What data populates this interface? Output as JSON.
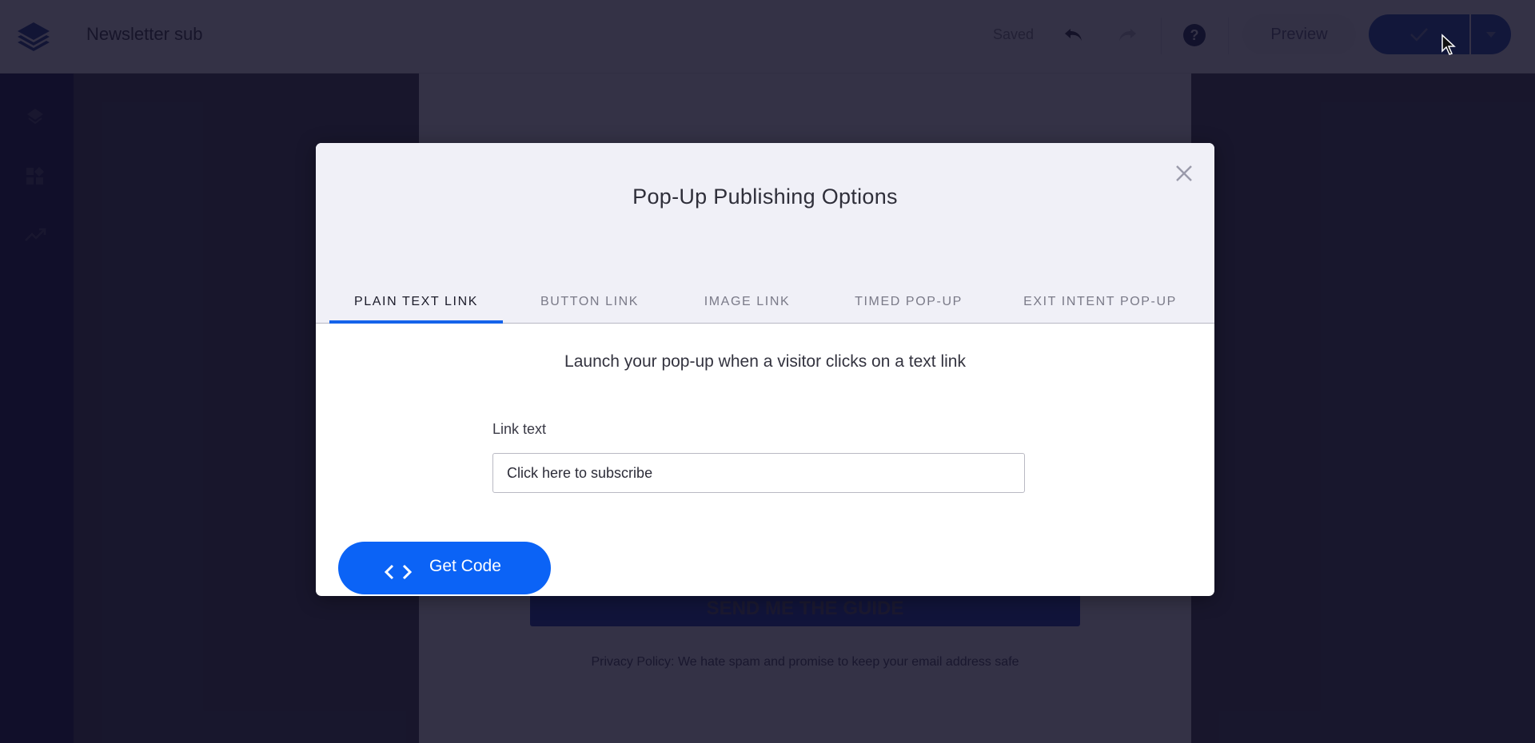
{
  "app": {
    "logo_icon": "layers-logo-icon",
    "document_title": "Newsletter sub",
    "save_status": "Saved",
    "toolbar": {
      "undo_icon": "undo-icon",
      "redo_icon": "redo-icon",
      "help_icon": "help-circle-icon",
      "preview_label": "Preview",
      "publish_icon": "checkmark-icon",
      "publish_menu_icon": "caret-down-icon"
    },
    "sidebar": {
      "items": [
        {
          "icon": "layers-icon",
          "name": "layers"
        },
        {
          "icon": "widgets-icon",
          "name": "widgets"
        },
        {
          "icon": "analytics-trend-icon",
          "name": "analytics"
        }
      ]
    },
    "canvas": {
      "cta_button": "SEND ME THE GUIDE",
      "privacy_text": "Privacy Policy: We hate spam and promise to keep your email address safe"
    }
  },
  "modal": {
    "title": "Pop-Up Publishing Options",
    "close_icon": "close-icon",
    "tabs": [
      {
        "label": "PLAIN TEXT LINK",
        "active": true
      },
      {
        "label": "BUTTON LINK",
        "active": false
      },
      {
        "label": "IMAGE LINK",
        "active": false
      },
      {
        "label": "TIMED POP-UP",
        "active": false
      },
      {
        "label": "EXIT INTENT POP-UP",
        "active": false
      }
    ],
    "subtitle": "Launch your pop-up when a visitor clicks on a text link",
    "link_text_label": "Link text",
    "link_text_value": "Click here to subscribe",
    "get_code_label": "Get Code",
    "get_code_icon": "code-brackets-icon"
  },
  "colors": {
    "accent": "#0b63f6",
    "tab_indicator": "#1563ea",
    "publish_button": "#0a3ea8",
    "sidebar": "#02003a"
  }
}
